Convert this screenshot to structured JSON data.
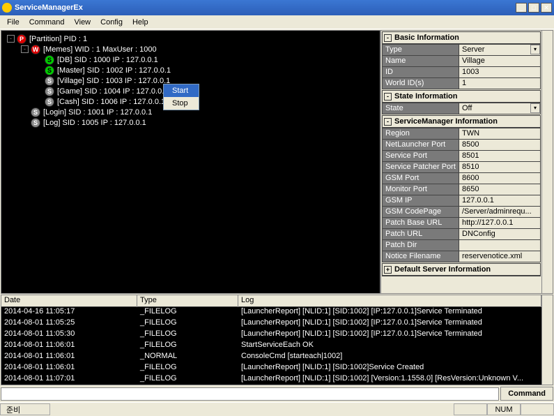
{
  "title": "ServiceManagerEx",
  "menus": [
    "File",
    "Command",
    "View",
    "Config",
    "Help"
  ],
  "tree": [
    {
      "indent": 0,
      "exp": "-",
      "badge": "P",
      "label": "[Partition] PID : 1"
    },
    {
      "indent": 1,
      "exp": "-",
      "badge": "W",
      "label": "[Memes] WID : 1 MaxUser : 1000"
    },
    {
      "indent": 2,
      "exp": "",
      "badge": "Sg",
      "label": "[DB] SID : 1000 IP : 127.0.0.1"
    },
    {
      "indent": 2,
      "exp": "",
      "badge": "Sg",
      "label": "[Master] SID : 1002 IP : 127.0.0.1"
    },
    {
      "indent": 2,
      "exp": "",
      "badge": "S",
      "label": "[Village] SID : 1003 IP : 127.0.0.1"
    },
    {
      "indent": 2,
      "exp": "",
      "badge": "S",
      "label": "[Game] SID : 1004 IP : 127.0.0.1"
    },
    {
      "indent": 2,
      "exp": "",
      "badge": "S",
      "label": "[Cash] SID : 1006 IP : 127.0.0.1"
    },
    {
      "indent": 1,
      "exp": "",
      "badge": "S",
      "label": "[Login] SID : 1001 IP : 127.0.0.1"
    },
    {
      "indent": 1,
      "exp": "",
      "badge": "S",
      "label": "[Log] SID : 1005 IP : 127.0.0.1"
    }
  ],
  "ctxMenu": {
    "items": [
      "Start",
      "Stop"
    ],
    "selected": 0
  },
  "groups": [
    {
      "title": "Basic Information",
      "collapsed": false,
      "rows": [
        {
          "k": "Type",
          "v": "Server",
          "dd": true
        },
        {
          "k": "Name",
          "v": "Village"
        },
        {
          "k": "ID",
          "v": "1003"
        },
        {
          "k": "World ID(s)",
          "v": "1"
        }
      ]
    },
    {
      "title": "State Information",
      "collapsed": false,
      "rows": [
        {
          "k": "State",
          "v": "Off",
          "dd": true
        }
      ]
    },
    {
      "title": "ServiceManager Information",
      "collapsed": false,
      "rows": [
        {
          "k": "Region",
          "v": "TWN"
        },
        {
          "k": "NetLauncher Port",
          "v": "8500"
        },
        {
          "k": "Service Port",
          "v": "8501"
        },
        {
          "k": "Service Patcher Port",
          "v": "8510"
        },
        {
          "k": "GSM Port",
          "v": "8600"
        },
        {
          "k": "Monitor Port",
          "v": "8650"
        },
        {
          "k": "GSM IP",
          "v": "127.0.0.1"
        },
        {
          "k": "GSM CodePage",
          "v": "/Server/adminrequ..."
        },
        {
          "k": "Patch Base URL",
          "v": "http://127.0.0.1"
        },
        {
          "k": "Patch URL",
          "v": "DNConfig"
        },
        {
          "k": "Patch Dir",
          "v": ""
        },
        {
          "k": "Notice Filename",
          "v": "reservenotice.xml"
        }
      ]
    },
    {
      "title": "Default Server Information",
      "collapsed": true,
      "rows": []
    }
  ],
  "logCols": [
    "Date",
    "Type",
    "Log"
  ],
  "logs": [
    {
      "date": "2014-04-16 11:05:17",
      "type": "_FILELOG",
      "log": "[LauncherReport] [NLID:1] [SID:1002] [IP:127.0.0.1]Service Terminated"
    },
    {
      "date": "2014-08-01 11:05:25",
      "type": "_FILELOG",
      "log": "[LauncherReport] [NLID:1] [SID:1002] [IP:127.0.0.1]Service Terminated"
    },
    {
      "date": "2014-08-01 11:05:30",
      "type": "_FILELOG",
      "log": "[LauncherReport] [NLID:1] [SID:1002] [IP:127.0.0.1]Service Terminated"
    },
    {
      "date": "2014-08-01 11:06:01",
      "type": "_FILELOG",
      "log": "StartServiceEach OK"
    },
    {
      "date": "2014-08-01 11:06:01",
      "type": "_NORMAL",
      "log": "ConsoleCmd [starteach|1002]"
    },
    {
      "date": "2014-08-01 11:06:01",
      "type": "_FILELOG",
      "log": "[LauncherReport] [NLID:1] [SID:1002]Service Created"
    },
    {
      "date": "2014-08-01 11:07:01",
      "type": "_FILELOG",
      "log": "[LauncherReport] [NLID:1] [SID:1002] [Version:1.1558.0] [ResVersion:Unknown V..."
    }
  ],
  "cmdButton": "Command",
  "status": {
    "left": "준비",
    "num": "NUM"
  }
}
